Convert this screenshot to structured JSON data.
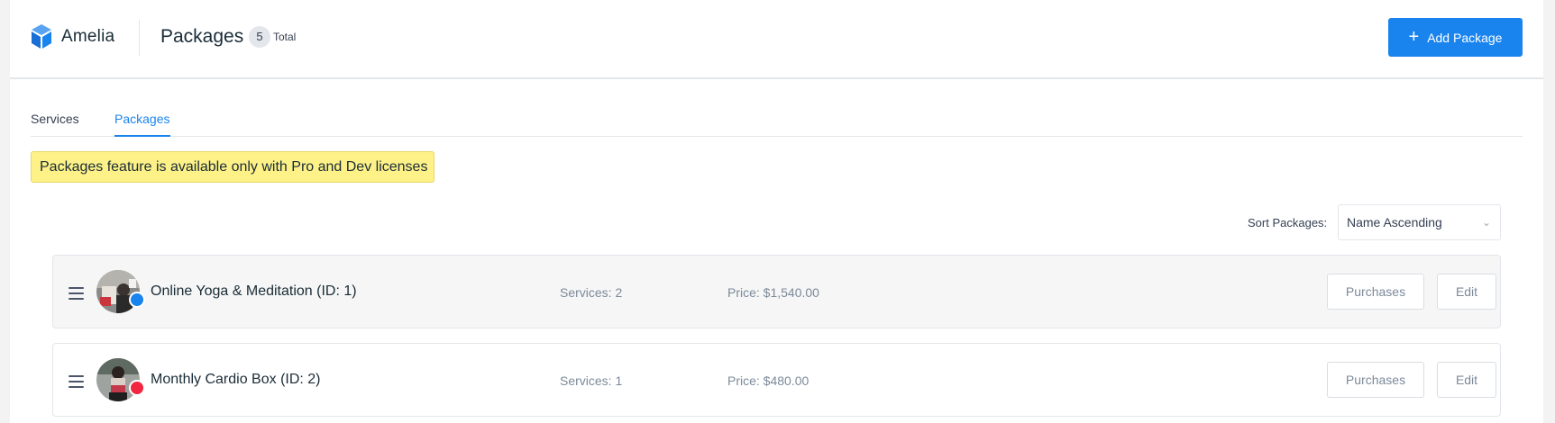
{
  "header": {
    "logo_text": "Amelia",
    "title": "Packages",
    "count": "5",
    "count_label": "Total",
    "add_button_label": "Add Package"
  },
  "tabs": [
    {
      "label": "Services",
      "active": false
    },
    {
      "label": "Packages",
      "active": true
    }
  ],
  "notice": "Packages feature is available only with Pro and Dev licenses",
  "sort": {
    "label": "Sort Packages:",
    "value": "Name Ascending"
  },
  "packages": [
    {
      "name": "Online Yoga & Meditation (ID: 1)",
      "services": "Services: 2",
      "price": "Price: $1,540.00",
      "purchases_label": "Purchases",
      "edit_label": "Edit",
      "color": "#1a84ee"
    },
    {
      "name": "Monthly Cardio Box (ID: 2)",
      "services": "Services: 1",
      "price": "Price: $480.00",
      "purchases_label": "Purchases",
      "edit_label": "Edit",
      "color": "#f0273f"
    }
  ],
  "colors": {
    "accent": "#1a84ee",
    "notice_bg": "#fdf187"
  }
}
